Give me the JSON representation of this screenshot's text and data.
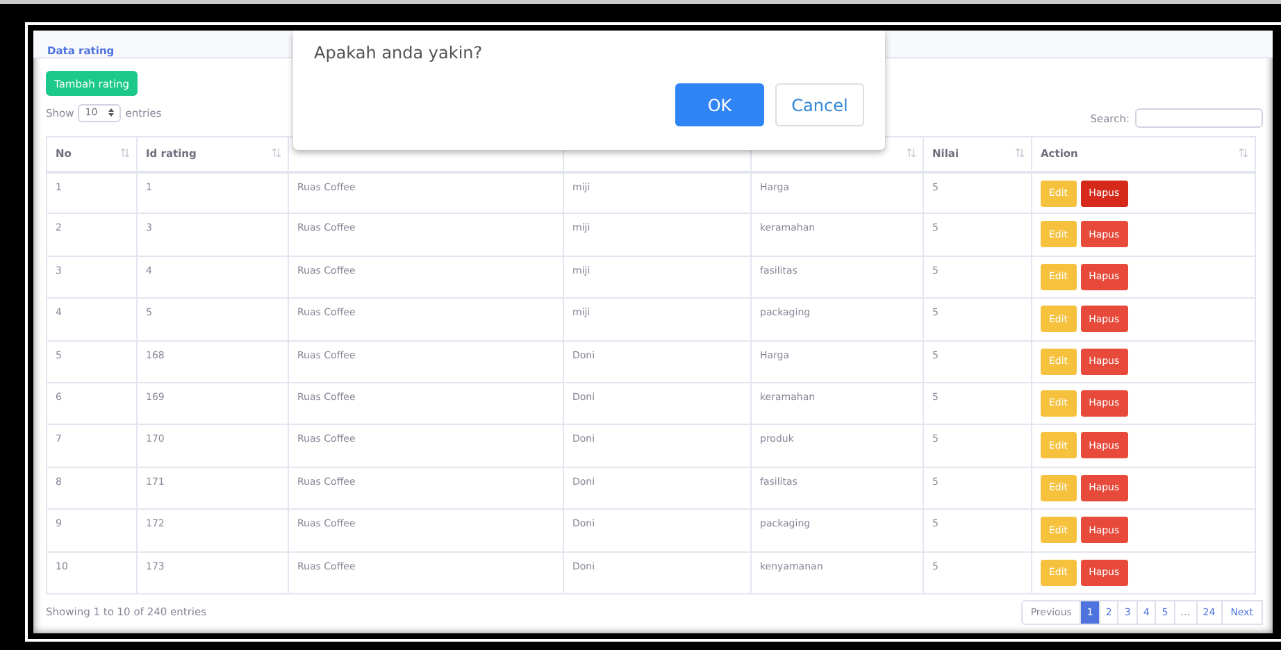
{
  "panel": {
    "title": "Data rating"
  },
  "add_button": "Tambah rating",
  "length": {
    "before": "Show",
    "value": "10",
    "after": "entries"
  },
  "search": {
    "label": "Search:"
  },
  "table": {
    "columns": [
      {
        "label": "No",
        "sort_icon": true
      },
      {
        "label": "Id rating",
        "sort_icon": true
      },
      {
        "sort_icon": false
      },
      {
        "sort_icon": false
      },
      {
        "sort_icon": true
      },
      {
        "label": "Nilai",
        "sort_icon": true
      },
      {
        "label": "Action",
        "sort_icon": true
      }
    ],
    "rows": [
      {
        "cells": [
          "1",
          "1",
          "Ruas Coffee",
          "miji",
          "Harga",
          "5"
        ],
        "edit": "Edit",
        "delete": "Hapus",
        "delete_pressed": true
      },
      {
        "cells": [
          "2",
          "3",
          "Ruas Coffee",
          "miji",
          "keramahan",
          "5"
        ],
        "edit": "Edit",
        "delete": "Hapus",
        "delete_pressed": false
      },
      {
        "cells": [
          "3",
          "4",
          "Ruas Coffee",
          "miji",
          "fasilitas",
          "5"
        ],
        "edit": "Edit",
        "delete": "Hapus",
        "delete_pressed": false
      },
      {
        "cells": [
          "4",
          "5",
          "Ruas Coffee",
          "miji",
          "packaging",
          "5"
        ],
        "edit": "Edit",
        "delete": "Hapus",
        "delete_pressed": false
      },
      {
        "cells": [
          "5",
          "168",
          "Ruas Coffee",
          "Doni",
          "Harga",
          "5"
        ],
        "edit": "Edit",
        "delete": "Hapus",
        "delete_pressed": false
      },
      {
        "cells": [
          "6",
          "169",
          "Ruas Coffee",
          "Doni",
          "keramahan",
          "5"
        ],
        "edit": "Edit",
        "delete": "Hapus",
        "delete_pressed": false
      },
      {
        "cells": [
          "7",
          "170",
          "Ruas Coffee",
          "Doni",
          "produk",
          "5"
        ],
        "edit": "Edit",
        "delete": "Hapus",
        "delete_pressed": false
      },
      {
        "cells": [
          "8",
          "171",
          "Ruas Coffee",
          "Doni",
          "fasilitas",
          "5"
        ],
        "edit": "Edit",
        "delete": "Hapus",
        "delete_pressed": false
      },
      {
        "cells": [
          "9",
          "172",
          "Ruas Coffee",
          "Doni",
          "packaging",
          "5"
        ],
        "edit": "Edit",
        "delete": "Hapus",
        "delete_pressed": false
      },
      {
        "cells": [
          "10",
          "173",
          "Ruas Coffee",
          "Doni",
          "kenyamanan",
          "5"
        ],
        "edit": "Edit",
        "delete": "Hapus",
        "delete_pressed": false
      }
    ]
  },
  "info": "Showing 1 to 10 of 240 entries",
  "pagination": [
    {
      "label": "Previous",
      "kind": "nav",
      "selected": false
    },
    {
      "label": "1",
      "kind": "page",
      "selected": true
    },
    {
      "label": "2",
      "kind": "page",
      "selected": false
    },
    {
      "label": "3",
      "kind": "page",
      "selected": false
    },
    {
      "label": "4",
      "kind": "page",
      "selected": false
    },
    {
      "label": "5",
      "kind": "page",
      "selected": false
    },
    {
      "label": "…",
      "kind": "gap",
      "selected": false
    },
    {
      "label": "24",
      "kind": "page",
      "selected": false
    },
    {
      "label": "Next",
      "kind": "nav",
      "selected": false
    }
  ],
  "dialog": {
    "message": "Apakah anda yakin?",
    "buttons": [
      {
        "label": "OK",
        "kind": "primary"
      },
      {
        "label": "Cancel",
        "kind": "secondary"
      }
    ]
  }
}
